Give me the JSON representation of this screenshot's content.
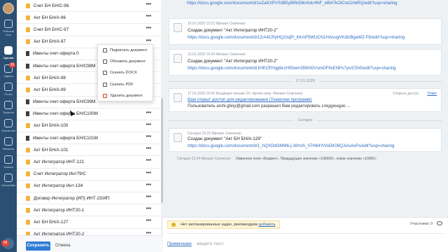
{
  "rail": {
    "items": [
      {
        "label": "Рабочий стол",
        "icon": "desktop-icon"
      },
      {
        "label": "Сделки",
        "icon": "deals-icon",
        "active": true
      },
      {
        "label": "Задачи",
        "icon": "tasks-icon",
        "badge": "30"
      },
      {
        "label": "Почта",
        "icon": "mail-icon"
      },
      {
        "label": "Проекты",
        "icon": "projects-icon"
      },
      {
        "label": "Аналитика",
        "icon": "analytics-icon"
      },
      {
        "label": "Финансы",
        "icon": "finance-icon"
      },
      {
        "label": "Знания",
        "icon": "knowledge-icon"
      },
      {
        "label": "Настройки",
        "icon": "settings-icon"
      }
    ],
    "bottom_badge": "28"
  },
  "documents": [
    {
      "name": "Счет БН БН/С-96",
      "type": "folder"
    },
    {
      "name": "Акт БН БН/А-96",
      "type": "folder"
    },
    {
      "name": "Счет БН БН/С-97",
      "type": "folder"
    },
    {
      "name": "Акт БН БН/А-97",
      "type": "folder"
    },
    {
      "name": "Ивенты счет-оферта 0",
      "type": "file"
    },
    {
      "name": "Ивенты счет-оферта БН/С98М",
      "type": "file"
    },
    {
      "name": "Акт БН БН/А-98",
      "type": "folder"
    },
    {
      "name": "Акт БН БН/А-99",
      "type": "folder"
    },
    {
      "name": "Ивенты счет-оферта БН/С99М",
      "type": "file"
    },
    {
      "name": "Ивенты счет-оферта БН/С100М",
      "type": "file"
    },
    {
      "name": "Акт БН БН/А-100",
      "type": "folder"
    },
    {
      "name": "Ивенты счет-оферта БН/С101М",
      "type": "file"
    },
    {
      "name": "Акт БН БН/А-101",
      "type": "folder"
    },
    {
      "name": "Акт Интегратор ИНТ-121",
      "type": "folder"
    },
    {
      "name": "Счет Интегратор Инт79/С",
      "type": "folder"
    },
    {
      "name": "Акт Интегратор Инт-134",
      "type": "folder"
    },
    {
      "name": "Договор Интегратор (ИП) ИНТ-23/ИП",
      "type": "folder"
    },
    {
      "name": "Акт Интегратор ИНТ20-1",
      "type": "folder"
    },
    {
      "name": "Акт БН БН/А-127",
      "type": "folder"
    },
    {
      "name": "Акт Интегратор ИНТ20-2",
      "type": "folder"
    }
  ],
  "row_menu_glyph": "•••",
  "context_menu": [
    {
      "label": "Подписать документ",
      "icon": "sign-icon"
    },
    {
      "label": "Обновить документ",
      "icon": "refresh-icon"
    },
    {
      "label": "Скачать DOCX",
      "icon": "download-icon"
    },
    {
      "label": "Скачать PDF",
      "icon": "pdf-icon"
    },
    {
      "label": "Удалить документ",
      "icon": "trash-icon",
      "danger": true
    }
  ],
  "footer": {
    "save": "Сохранить",
    "cancel": "Отмена"
  },
  "activity": {
    "top_link": "https://docs.google.com/document/d/1oZaKXPVS3B5yBRkD6mfckr4NF_klB47kOiCw11hbRQ/edit?usp=sharing",
    "card1": {
      "meta": "15.01.2020 19:22 Михаил Семченко",
      "title": "Создан документ \"Акт Интегратор ИНТ20-2\"",
      "link": "https://docs.google.com/document/d/12rA4CPpHQ2zqPi_KKAP5WUCN1HAnugVKdtzBgaWZ-F8/edit?usp=sharing"
    },
    "card2": {
      "meta": "15.01.2020 19:24 Михаил Семченко",
      "title": "Создан документ \"Акт Интегратор ИНТ20-2\"",
      "link": "https://docs.google.com/document/d/1HECRYqg8e1H55wm356Hl2VsmOF9sENPs7yxrC5h0/edit?usp=sharing"
    },
    "date_divider": "17.01.2020",
    "email": {
      "meta": "17.01.2020 16:42 Входящее письмо От: Артем кому: Михаил Семченко",
      "subject": "Вам открыт доступ для редактирования (Тематики программ)",
      "body": "Пользователь archi.gboy@gmail.com разрешил Вам редактировать следующую ...",
      "action_open": "Открыть доступ",
      "action_reply": "Ответ"
    },
    "today_divider": "Сегодня",
    "card3": {
      "meta": "Сегодня 15:23 Михаил Семченко",
      "title": "Создан документ \"Акт БН БН/А-129\"",
      "link": "https://docs.google.com/document/d/1_hQXOdGMM6-j-30nVA_07H64YiVoDK08QJvIuAvPs/edit?usp=sharing"
    },
    "log": {
      "who": "Сегодня 15:24 Михаил Семченко",
      "text": "Изменено поле «Бюджет». Предыдущее значение «106000», новое значение «10000»"
    }
  },
  "tasks": {
    "note": "Нет запланированных задач, рекомендуем",
    "add": "добавить",
    "participants": "Участники: 0",
    "comment_label": "Примечание",
    "comment_placeholder": "введите текст"
  }
}
